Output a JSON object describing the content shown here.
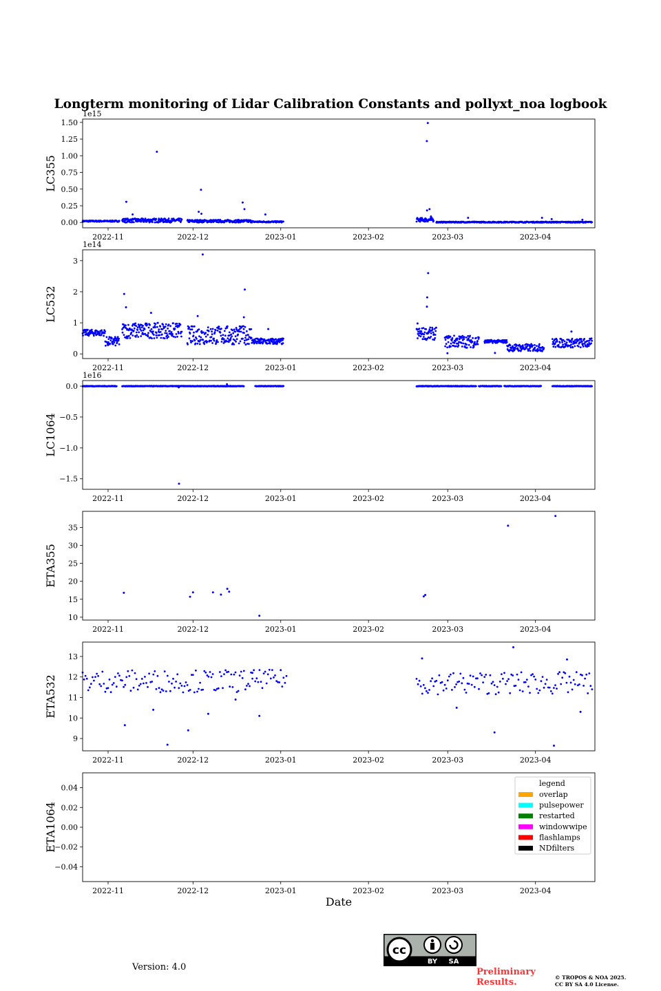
{
  "title": "Longterm monitoring of Lidar Calibration Constants and pollyxt_noa logbook",
  "footer": {
    "version": "Version: 4.0",
    "preliminary": [
      "Preliminary",
      "Results."
    ],
    "copyright": [
      "© TROPOS & NOA 2025.",
      "CC BY SA 4.0 License."
    ],
    "license_badge": {
      "left": "BY",
      "right": "SA"
    }
  },
  "colors": {
    "points": "#0000ff",
    "frame": "#000000"
  },
  "chart_data": [
    {
      "type": "scatter",
      "ylabel": "LC355",
      "offset_label": "1e15",
      "ylim": [
        -0.08,
        1.55
      ],
      "yticks": [
        0,
        0.25,
        0.5,
        0.75,
        1.0,
        1.25,
        1.5
      ],
      "ytick_labels": [
        "0.00",
        "0.25",
        "0.50",
        "0.75",
        "1.00",
        "1.25",
        "1.50"
      ],
      "xlim": [
        "2022-10-23",
        "2023-04-22"
      ],
      "xticks": [
        "2022-11-01",
        "2022-12-01",
        "2023-01-01",
        "2023-02-01",
        "2023-03-01",
        "2023-04-01"
      ],
      "xtick_labels": [
        "2022-11",
        "2022-12",
        "2023-01",
        "2023-02",
        "2023-03",
        "2023-04"
      ],
      "segments": [
        {
          "from": "2022-10-23",
          "to": "2022-11-05",
          "base": 0.02,
          "jitter": 0.01
        },
        {
          "from": "2022-11-06",
          "to": "2022-11-27",
          "base": 0.03,
          "jitter": 0.03
        },
        {
          "from": "2022-11-29",
          "to": "2022-12-22",
          "base": 0.02,
          "jitter": 0.02
        },
        {
          "from": "2022-12-22",
          "to": "2023-01-02",
          "base": 0.01,
          "jitter": 0.01
        },
        {
          "from": "2023-02-18",
          "to": "2023-02-24",
          "base": 0.04,
          "jitter": 0.03
        },
        {
          "from": "2023-02-25",
          "to": "2023-04-21",
          "base": 0.005,
          "jitter": 0.008
        }
      ],
      "points": [
        [
          "2022-11-07",
          0.31
        ],
        [
          "2022-11-10",
          0.12
        ],
        [
          "2022-11-18",
          1.06
        ],
        [
          "2022-12-04",
          0.49
        ],
        [
          "2022-12-03",
          0.16
        ],
        [
          "2022-12-04",
          0.13
        ],
        [
          "2022-12-19",
          0.3
        ],
        [
          "2022-12-19",
          0.2
        ],
        [
          "2022-12-27",
          0.12
        ],
        [
          "2023-02-22",
          1.49
        ],
        [
          "2023-02-22",
          1.22
        ],
        [
          "2023-02-23",
          0.2
        ],
        [
          "2023-02-22",
          0.18
        ],
        [
          "2023-02-23",
          0.09
        ],
        [
          "2023-03-08",
          0.07
        ],
        [
          "2023-04-03",
          0.07
        ],
        [
          "2023-04-07",
          0.05
        ],
        [
          "2023-04-18",
          0.04
        ]
      ]
    },
    {
      "type": "scatter",
      "ylabel": "LC532",
      "offset_label": "1e14",
      "ylim": [
        -0.15,
        3.35
      ],
      "yticks": [
        0,
        1,
        2,
        3
      ],
      "ytick_labels": [
        "0",
        "1",
        "2",
        "3"
      ],
      "xlim": [
        "2022-10-23",
        "2023-04-22"
      ],
      "xticks": [
        "2022-11-01",
        "2022-12-01",
        "2023-01-01",
        "2023-02-01",
        "2023-03-01",
        "2023-04-01"
      ],
      "xtick_labels": [
        "2022-11",
        "2022-12",
        "2023-01",
        "2023-02",
        "2023-03",
        "2023-04"
      ],
      "segments": [
        {
          "from": "2022-10-23",
          "to": "2022-10-31",
          "base": 0.68,
          "jitter": 0.1
        },
        {
          "from": "2022-10-31",
          "to": "2022-11-05",
          "base": 0.4,
          "jitter": 0.15
        },
        {
          "from": "2022-11-06",
          "to": "2022-11-27",
          "base": 0.75,
          "jitter": 0.25
        },
        {
          "from": "2022-11-29",
          "to": "2022-12-22",
          "base": 0.6,
          "jitter": 0.3
        },
        {
          "from": "2022-12-22",
          "to": "2023-01-02",
          "base": 0.4,
          "jitter": 0.1
        },
        {
          "from": "2023-02-18",
          "to": "2023-02-25",
          "base": 0.65,
          "jitter": 0.2
        },
        {
          "from": "2023-02-28",
          "to": "2023-03-12",
          "base": 0.4,
          "jitter": 0.2
        },
        {
          "from": "2023-03-14",
          "to": "2023-03-22",
          "base": 0.4,
          "jitter": 0.05
        },
        {
          "from": "2023-03-22",
          "to": "2023-04-04",
          "base": 0.2,
          "jitter": 0.12
        },
        {
          "from": "2023-04-07",
          "to": "2023-04-21",
          "base": 0.35,
          "jitter": 0.15
        }
      ],
      "points": [
        [
          "2022-11-07",
          1.93
        ],
        [
          "2022-11-07",
          1.5
        ],
        [
          "2022-12-04",
          3.2
        ],
        [
          "2022-12-03",
          1.22
        ],
        [
          "2022-11-16",
          1.32
        ],
        [
          "2022-12-19",
          2.07
        ],
        [
          "2022-12-19",
          1.18
        ],
        [
          "2022-12-28",
          0.8
        ],
        [
          "2023-02-22",
          2.6
        ],
        [
          "2023-02-22",
          1.82
        ],
        [
          "2023-02-22",
          1.52
        ],
        [
          "2023-02-18",
          0.98
        ],
        [
          "2023-03-01",
          0.02
        ],
        [
          "2023-03-18",
          0.03
        ],
        [
          "2023-04-14",
          0.72
        ]
      ]
    },
    {
      "type": "scatter",
      "ylabel": "LC1064",
      "offset_label": "1e16",
      "ylim": [
        -1.67,
        0.09
      ],
      "yticks": [
        0,
        -0.5,
        -1.0,
        -1.5
      ],
      "ytick_labels": [
        "0.0",
        "−0.5",
        "−1.0",
        "−1.5"
      ],
      "xlim": [
        "2022-10-23",
        "2023-04-22"
      ],
      "xticks": [
        "2022-11-01",
        "2022-12-01",
        "2023-01-01",
        "2023-02-01",
        "2023-03-01",
        "2023-04-01"
      ],
      "xtick_labels": [
        "2022-11",
        "2022-12",
        "2023-01",
        "2023-02",
        "2023-03",
        "2023-04"
      ],
      "segments": [
        {
          "from": "2022-10-23",
          "to": "2022-11-04",
          "base": 0.0,
          "jitter": 0.004
        },
        {
          "from": "2022-11-06",
          "to": "2022-12-19",
          "base": 0.0,
          "jitter": 0.004
        },
        {
          "from": "2022-12-23",
          "to": "2023-01-02",
          "base": 0.0,
          "jitter": 0.004
        },
        {
          "from": "2023-02-18",
          "to": "2023-03-11",
          "base": 0.0,
          "jitter": 0.004
        },
        {
          "from": "2023-03-12",
          "to": "2023-03-20",
          "base": 0.0,
          "jitter": 0.004
        },
        {
          "from": "2023-03-21",
          "to": "2023-04-03",
          "base": 0.0,
          "jitter": 0.004
        },
        {
          "from": "2023-04-07",
          "to": "2023-04-21",
          "base": 0.0,
          "jitter": 0.004
        }
      ],
      "points": [
        [
          "2022-11-26",
          -1.58
        ],
        [
          "2022-12-13",
          0.03
        ],
        [
          "2022-11-26",
          -0.02
        ]
      ]
    },
    {
      "type": "scatter",
      "ylabel": "ETA355",
      "ylim": [
        9.2,
        39.5
      ],
      "yticks": [
        10,
        15,
        20,
        25,
        30,
        35
      ],
      "ytick_labels": [
        "10",
        "15",
        "20",
        "25",
        "30",
        "35"
      ],
      "xlim": [
        "2022-10-23",
        "2023-04-22"
      ],
      "xticks": [
        "2022-11-01",
        "2022-12-01",
        "2023-01-01",
        "2023-02-01",
        "2023-03-01",
        "2023-04-01"
      ],
      "xtick_labels": [
        "2022-11",
        "2022-12",
        "2023-01",
        "2023-02",
        "2023-03",
        "2023-04"
      ],
      "segments": [],
      "points": [
        [
          "2022-11-07",
          16.8
        ],
        [
          "2022-11-30",
          15.7
        ],
        [
          "2022-12-01",
          16.9
        ],
        [
          "2022-12-08",
          16.9
        ],
        [
          "2022-12-11",
          16.3
        ],
        [
          "2022-12-13",
          17.9
        ],
        [
          "2022-12-14",
          17.1
        ],
        [
          "2022-12-24",
          10.4
        ],
        [
          "2023-02-21",
          15.8
        ],
        [
          "2023-02-21",
          16.2
        ],
        [
          "2023-03-22",
          35.5
        ],
        [
          "2023-04-08",
          38.2
        ]
      ]
    },
    {
      "type": "scatter",
      "ylabel": "ETA532",
      "ylim": [
        8.4,
        13.7
      ],
      "yticks": [
        9,
        10,
        11,
        12,
        13
      ],
      "ytick_labels": [
        "9",
        "10",
        "11",
        "12",
        "13"
      ],
      "xlim": [
        "2022-10-23",
        "2023-04-22"
      ],
      "xticks": [
        "2022-11-01",
        "2022-12-01",
        "2023-01-01",
        "2023-02-01",
        "2023-03-01",
        "2023-04-01"
      ],
      "xtick_labels": [
        "2022-11",
        "2022-12",
        "2023-01",
        "2023-02",
        "2023-03",
        "2023-04"
      ],
      "segments": [
        {
          "from": "2022-10-23",
          "to": "2022-12-22",
          "base": 11.8,
          "jitter": 0.55,
          "step": 0.5
        },
        {
          "from": "2022-12-22",
          "to": "2023-01-03",
          "base": 11.9,
          "jitter": 0.45,
          "step": 0.5
        },
        {
          "from": "2023-02-18",
          "to": "2023-04-21",
          "base": 11.7,
          "jitter": 0.55,
          "step": 0.5
        }
      ],
      "points": [
        [
          "2022-11-07",
          9.65
        ],
        [
          "2022-11-22",
          8.7
        ],
        [
          "2022-11-29",
          9.4
        ],
        [
          "2022-12-06",
          10.2
        ],
        [
          "2022-12-24",
          10.1
        ],
        [
          "2022-12-16",
          10.9
        ],
        [
          "2022-11-17",
          10.4
        ],
        [
          "2023-03-18",
          9.3
        ],
        [
          "2023-03-24",
          13.45
        ],
        [
          "2023-04-08",
          8.65
        ],
        [
          "2023-04-17",
          10.3
        ],
        [
          "2023-03-04",
          10.5
        ],
        [
          "2023-02-20",
          12.9
        ],
        [
          "2023-04-12",
          12.85
        ]
      ]
    },
    {
      "type": "scatter",
      "ylabel": "ETA1064",
      "xlabel": "Date",
      "ylim": [
        -0.055,
        0.055
      ],
      "yticks": [
        0.04,
        0.02,
        0,
        -0.02,
        -0.04
      ],
      "ytick_labels": [
        "0.04",
        "0.02",
        "0.00",
        "−0.02",
        "−0.04"
      ],
      "xlim": [
        "2022-10-23",
        "2023-04-22"
      ],
      "xticks": [
        "2022-11-01",
        "2022-12-01",
        "2023-01-01",
        "2023-02-01",
        "2023-03-01",
        "2023-04-01"
      ],
      "xtick_labels": [
        "2022-11",
        "2022-12",
        "2023-01",
        "2023-02",
        "2023-03",
        "2023-04"
      ],
      "segments": [],
      "points": [],
      "legend": {
        "title": "legend",
        "placement": "top-right",
        "entries": [
          {
            "label": "overlap",
            "color": "#ffa500"
          },
          {
            "label": "pulsepower",
            "color": "#00ffff"
          },
          {
            "label": "restarted",
            "color": "#008000"
          },
          {
            "label": "windowwipe",
            "color": "#ff00ff"
          },
          {
            "label": "flashlamps",
            "color": "#ff0000"
          },
          {
            "label": "NDfilters",
            "color": "#000000"
          }
        ]
      }
    }
  ]
}
